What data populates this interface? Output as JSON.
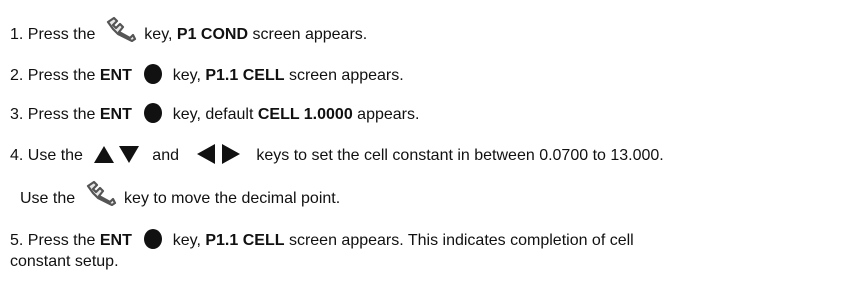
{
  "steps": {
    "s1": {
      "num": "1.",
      "pre": "Press the",
      "post_key": "key,",
      "bold": "P1 COND",
      "post": "screen appears."
    },
    "s2": {
      "num": "2.",
      "pre": "Press the",
      "bold_key": "ENT",
      "post_key": "key,",
      "bold": "P1.1 CELL",
      "post": "screen appears."
    },
    "s3": {
      "num": "3.",
      "pre": "Press the",
      "bold_key": "ENT",
      "post_key": "key, default",
      "bold": "CELL 1.0000",
      "post": "appears."
    },
    "s4": {
      "num": "4.",
      "pre": "Use the",
      "mid": "and",
      "post": "keys to set the cell constant in between 0.0700 to 13.000.",
      "continuation_pre": "Use the",
      "continuation_post": "key to move the decimal point."
    },
    "s5": {
      "num": "5.",
      "pre": "Press the",
      "bold_key": "ENT",
      "post_key": "key,",
      "bold": "P1.1 CELL",
      "post": "screen appears. This indicates completion of cell",
      "line2": "constant setup."
    }
  },
  "icons": {
    "wrench": "wrench-icon",
    "enter": "enter-key-icon",
    "up": "up-arrow-icon",
    "down": "down-arrow-icon",
    "left": "left-arrow-icon",
    "right": "right-arrow-icon"
  }
}
